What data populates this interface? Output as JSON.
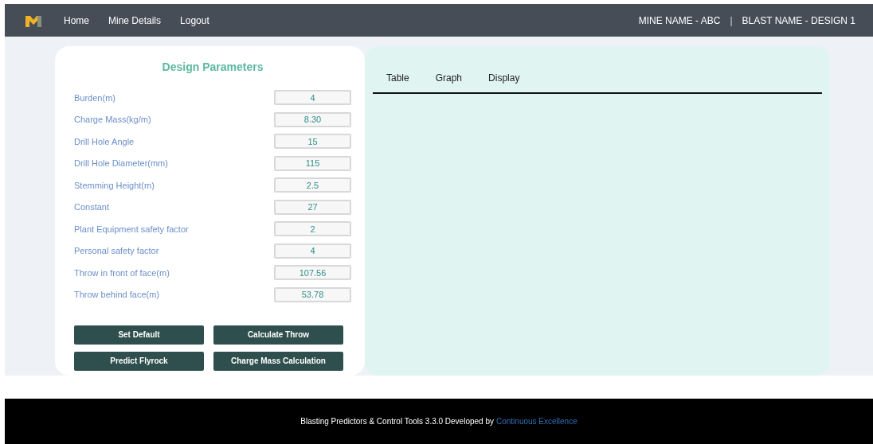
{
  "nav": {
    "links": [
      "Home",
      "Mine Details",
      "Logout"
    ],
    "mine": "MINE NAME -  ABC",
    "separator": "|",
    "blast": "BLAST NAME -  DESIGN 1"
  },
  "design": {
    "title": "Design Parameters",
    "params": [
      {
        "label": "Burden(m)",
        "value": "4"
      },
      {
        "label": "Charge Mass(kg/m)",
        "value": "8.30"
      },
      {
        "label": "Drill Hole Angle",
        "value": "15"
      },
      {
        "label": "Drill Hole Diameter(mm)",
        "value": "115"
      },
      {
        "label": "Stemming Height(m)",
        "value": "2.5"
      },
      {
        "label": "Constant",
        "value": "27"
      },
      {
        "label": "Plant Equipment safety factor",
        "value": "2"
      },
      {
        "label": "Personal safety factor",
        "value": "4"
      },
      {
        "label": "Throw in front of face(m)",
        "value": "107.56"
      },
      {
        "label": "Throw behind face(m)",
        "value": "53.78"
      }
    ],
    "buttons": [
      "Set Default",
      "Calculate Throw",
      "Predict Flyrock",
      "Charge Mass Calculation"
    ]
  },
  "tabs": [
    "Table",
    "Graph",
    "Display"
  ],
  "footer": {
    "text": "Blasting Predictors & Control Tools 3.3.0 Developed by",
    "link": "Continuous Excellence"
  }
}
